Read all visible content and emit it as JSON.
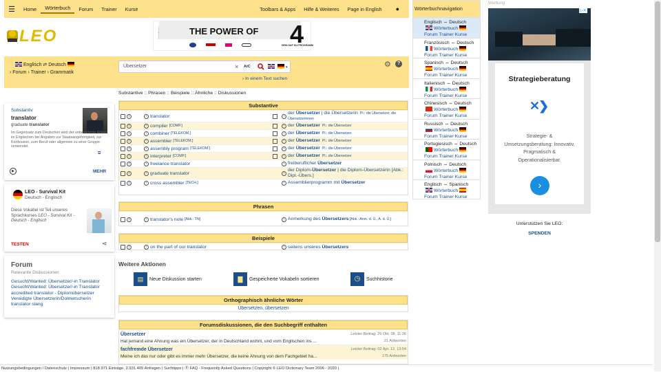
{
  "nav": {
    "home": "Home",
    "woerterbuch": "Wörterbuch",
    "forum": "Forum",
    "trainer": "Trainer",
    "kurse": "Kurse",
    "tools": "Toolbars & Apps",
    "hilfe": "Hilfe & Weiteres",
    "english": "Page in English"
  },
  "logo": {
    "text": "LEO"
  },
  "banner": {
    "side_label": "Werbung",
    "headline": "THE POWER OF",
    "digit": "4",
    "subline": "DEIN SAP S/4 PROGRAMM"
  },
  "lang_selector": {
    "from": "Englisch",
    "arrow": "⇄",
    "to": "Deutsch"
  },
  "subnav": {
    "forum": "Forum",
    "trainer": "Trainer",
    "grammatik": "Grammatik"
  },
  "search": {
    "value": "Übersetzer",
    "clear": "×",
    "special_chars": "AtC",
    "in_text": "In einem Text suchen"
  },
  "category_links": [
    "Substantive",
    "Phrasen",
    "Beispiele",
    "Ähnliche",
    "Diskussionen"
  ],
  "word_card": {
    "type": "Substantiv",
    "word": "translator",
    "sub_prefix": "graduate ",
    "sub_word": "translator",
    "text": "Im Gegensatz zum Deutschen wird der unbestimmte Artikel im Englischen bei Angaben zur Staatsangehörigkeit, zur Konfession, zum Beruf oder allgemein zu einer Gruppe verwendet.",
    "more": "MEHR"
  },
  "survival_card": {
    "title": "LEO - Survival Kit",
    "subtitle": "Deutsch - Englisch",
    "text_pre": "Diese Vokabel ist Teil unseres Sprachkurses ",
    "text_em": "LEO - Survival Kit - Deutsch - Englisch",
    "cta": "TESTEN"
  },
  "forum_card": {
    "title": "Forum",
    "subtitle": "Relevante Diskussionen",
    "links": [
      "Gesucht/Wanted: Übersetzer/-in Translator",
      "Gesucht/Wanted: Übersetzer/-in Translator",
      "accredited translator - Diplomübersetzer",
      "Vereidigte Übersetzerin/Dolmetscherin",
      "translator slang"
    ]
  },
  "substantive": {
    "header": "Substantive",
    "rows": [
      {
        "en": "translator",
        "en_tag": "",
        "de_pre": "der ",
        "de_bold": "Übersetzer",
        "de_post": " | die Übersetzerin",
        "pl": "Pl.: die Übersetzer, die Übersetzerinnen"
      },
      {
        "en": "compiler",
        "en_tag": "[COMP.]",
        "de_pre": "der ",
        "de_bold": "Übersetzer",
        "de_post": "",
        "pl": "Pl.: die Übersetzer"
      },
      {
        "en": "combiner",
        "en_tag": "[TELEKOM.]",
        "de_pre": "der ",
        "de_bold": "Übersetzer",
        "de_post": "",
        "pl": "Pl.: die Übersetzer"
      },
      {
        "en": "assembler",
        "en_tag": "[TELEKOM.]",
        "de_pre": "der ",
        "de_bold": "Übersetzer",
        "de_post": "",
        "pl": "Pl.: die Übersetzer"
      },
      {
        "en": "assembly program",
        "en_tag": "[TELEKOM.]",
        "de_pre": "der ",
        "de_bold": "Übersetzer",
        "de_post": "",
        "pl": "Pl.: die Übersetzer"
      },
      {
        "en": "interpreter",
        "en_tag": "[COMP.]",
        "de_pre": "der ",
        "de_bold": "Übersetzer",
        "de_post": "",
        "pl": "Pl.: die Übersetzer"
      },
      {
        "en": "freelance translator",
        "en_tag": "",
        "de_pre": "freiberuflicher ",
        "de_bold": "Übersetzer",
        "de_post": "",
        "pl": ""
      },
      {
        "en": "graduate translator",
        "en_tag": "",
        "de_pre": "der Diplom-",
        "de_bold": "Übersetzer",
        "de_post": " | die Diplom-Übersetzerin [Abk.: Dipl.-Übers.]",
        "pl": ""
      },
      {
        "en": "cross assembler",
        "en_tag": "[TECH.]",
        "de_pre": "Assemblierprogramm mit ",
        "de_bold": "Übersetzer",
        "de_post": "",
        "pl": ""
      }
    ]
  },
  "phrasen": {
    "header": "Phrasen",
    "en": "translator's note",
    "en_tag": "[Abk.: TN]",
    "de_pre": "Anmerkung des ",
    "de_bold": "Übersetzers",
    "de_post": " [Abk.: Anm. d. Ü., A. d. Ü.]"
  },
  "beispiele": {
    "header": "Beispiele",
    "en": "on the part of our translator",
    "de_pre": "seitens unseres ",
    "de_bold": "Übersetzers"
  },
  "actions": {
    "title": "Weitere Aktionen",
    "a1": "Neue Diskussion starten",
    "a2": "Gespeicherte Vokabeln sortieren",
    "a3": "Suchhistorie"
  },
  "ortho": {
    "header": "Orthographisch ähnliche Wörter",
    "words": "Übersetzen, übersetzen"
  },
  "forumdisc": {
    "header": "Forumsdiskussionen, die den Suchbegriff enthalten",
    "items": [
      {
        "title": "Übersetzer",
        "text": "Hat jemand eine Ahnung was ein Übersetzer, der in Deutschland wohnt, und vom Englischen ins ...",
        "date": "Letzter Beitrag: 29 Okt. 08, 11:26",
        "answers": "21 Antworten"
      },
      {
        "title": "fachfremde Übersetzer",
        "text": "Meine ich das nur oder gibt es immer mehr Übersetzer, die keine Ahnung von dem Fachgebiet ha...",
        "date": "Letzter Beitrag: 02 Apr. 12, 13:54",
        "answers": "175 Antworten"
      }
    ]
  },
  "rnav": {
    "title": "Wörterbuchnavigation",
    "wb": "Wörterbuch",
    "ftk": "Forum Trainer Kurse",
    "groups": [
      {
        "label": "Englisch ⇔ Deutsch",
        "flag": "en",
        "sel": true
      },
      {
        "label": "Französisch ⇔ Deutsch",
        "flag": "fr"
      },
      {
        "label": "Spanisch ⇔ Deutsch",
        "flag": "es"
      },
      {
        "label": "Italienisch ⇔ Deutsch",
        "flag": "it"
      },
      {
        "label": "Chinesisch ⇔ Deutsch",
        "flag": "cn"
      },
      {
        "label": "Russisch ⇔ Deutsch",
        "flag": "ru"
      },
      {
        "label": "Portugiesisch ⇔ Deutsch",
        "flag": "pt"
      },
      {
        "label": "Polnisch ⇔ Deutsch",
        "flag": "pl"
      },
      {
        "label": "Englisch ⇔ Spanisch",
        "flag": "en",
        "flag2": "es"
      }
    ]
  },
  "ad": {
    "label": "Werbung",
    "title": "Strategieberatung",
    "text": "Strategie- & Umsetzungsberatung: Innovativ, Pragmatisch & Operationalisierbar.",
    "support": "Unterstützen Sie LEO:",
    "donate": "SPENDEN"
  },
  "footer": {
    "text": "Nutzungsbedingungen / Datenschutz | Impressum | 818.971 Einträge, 2.931.405 Anfragen | Suchtipps | ⓠ FAQ - Frequently Asked Questions | Copyright © LEO Dictionary Team 2006 - 2020 |"
  }
}
